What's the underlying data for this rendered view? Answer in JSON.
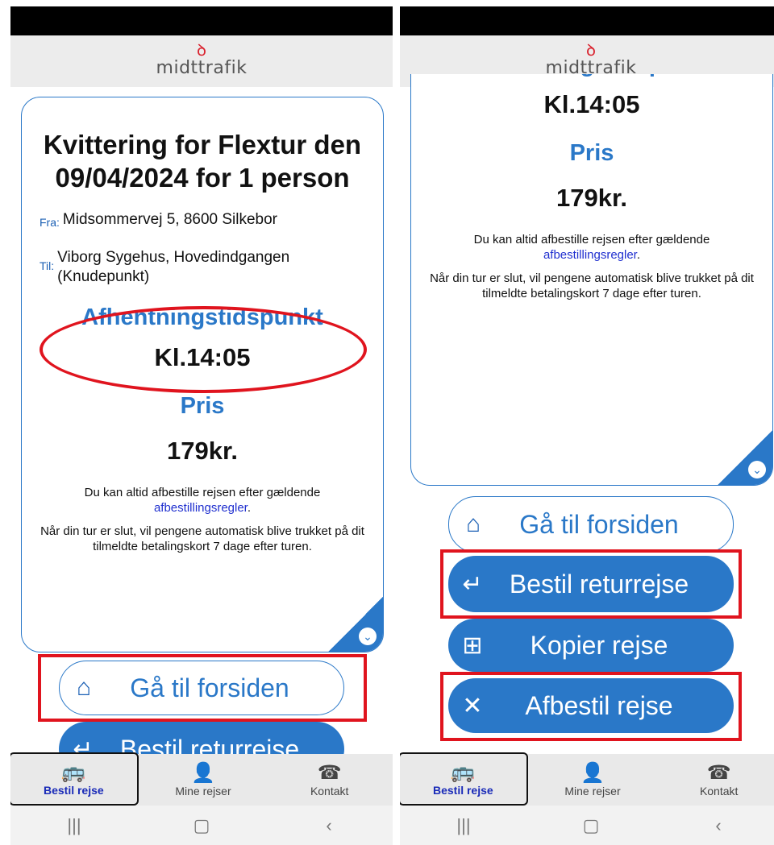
{
  "logo": {
    "icon": "ꝺ",
    "text": "midttrafik"
  },
  "receipt": {
    "title": "Kvittering for Flextur den 09/04/2024 for 1 person",
    "fra_label": "Fra:",
    "fra_value": "Midsommervej 5, 8600 Silkebor",
    "til_label": "Til:",
    "til_value": "Viborg Sygehus, Hovedindgangen (Knudepunkt)",
    "pickup_heading": "Afhentningstidspunkt",
    "pickup_time": "Kl.14:05",
    "price_heading": "Pris",
    "price_value": "179kr.",
    "note1_pre": "Du kan altid afbestille rejsen efter gældende",
    "note1_link": "afbestillingsregler",
    "note1_post": ".",
    "note2": "Når din tur er slut, vil pengene automatisk blive trukket på dit tilmeldte betalingskort 7 dage efter turen."
  },
  "buttons": {
    "home": "Gå til forsiden",
    "return": "Bestil returrejse",
    "copy": "Kopier rejse",
    "cancel": "Afbestil rejse"
  },
  "icons": {
    "home": "⌂",
    "return": "↵",
    "copy": "⊞",
    "cancel": "✕",
    "expand": "⌄",
    "bus": "🚌",
    "person": "👤",
    "phone": "☎"
  },
  "nav": {
    "bestil": "Bestil rejse",
    "mine": "Mine rejser",
    "kontakt": "Kontakt"
  },
  "sysnav": {
    "recent": "|||",
    "home": "▢",
    "back": "‹"
  },
  "colors": {
    "brand": "#2a78c8",
    "highlight": "#e0141e",
    "active": "#1a2bb8"
  }
}
